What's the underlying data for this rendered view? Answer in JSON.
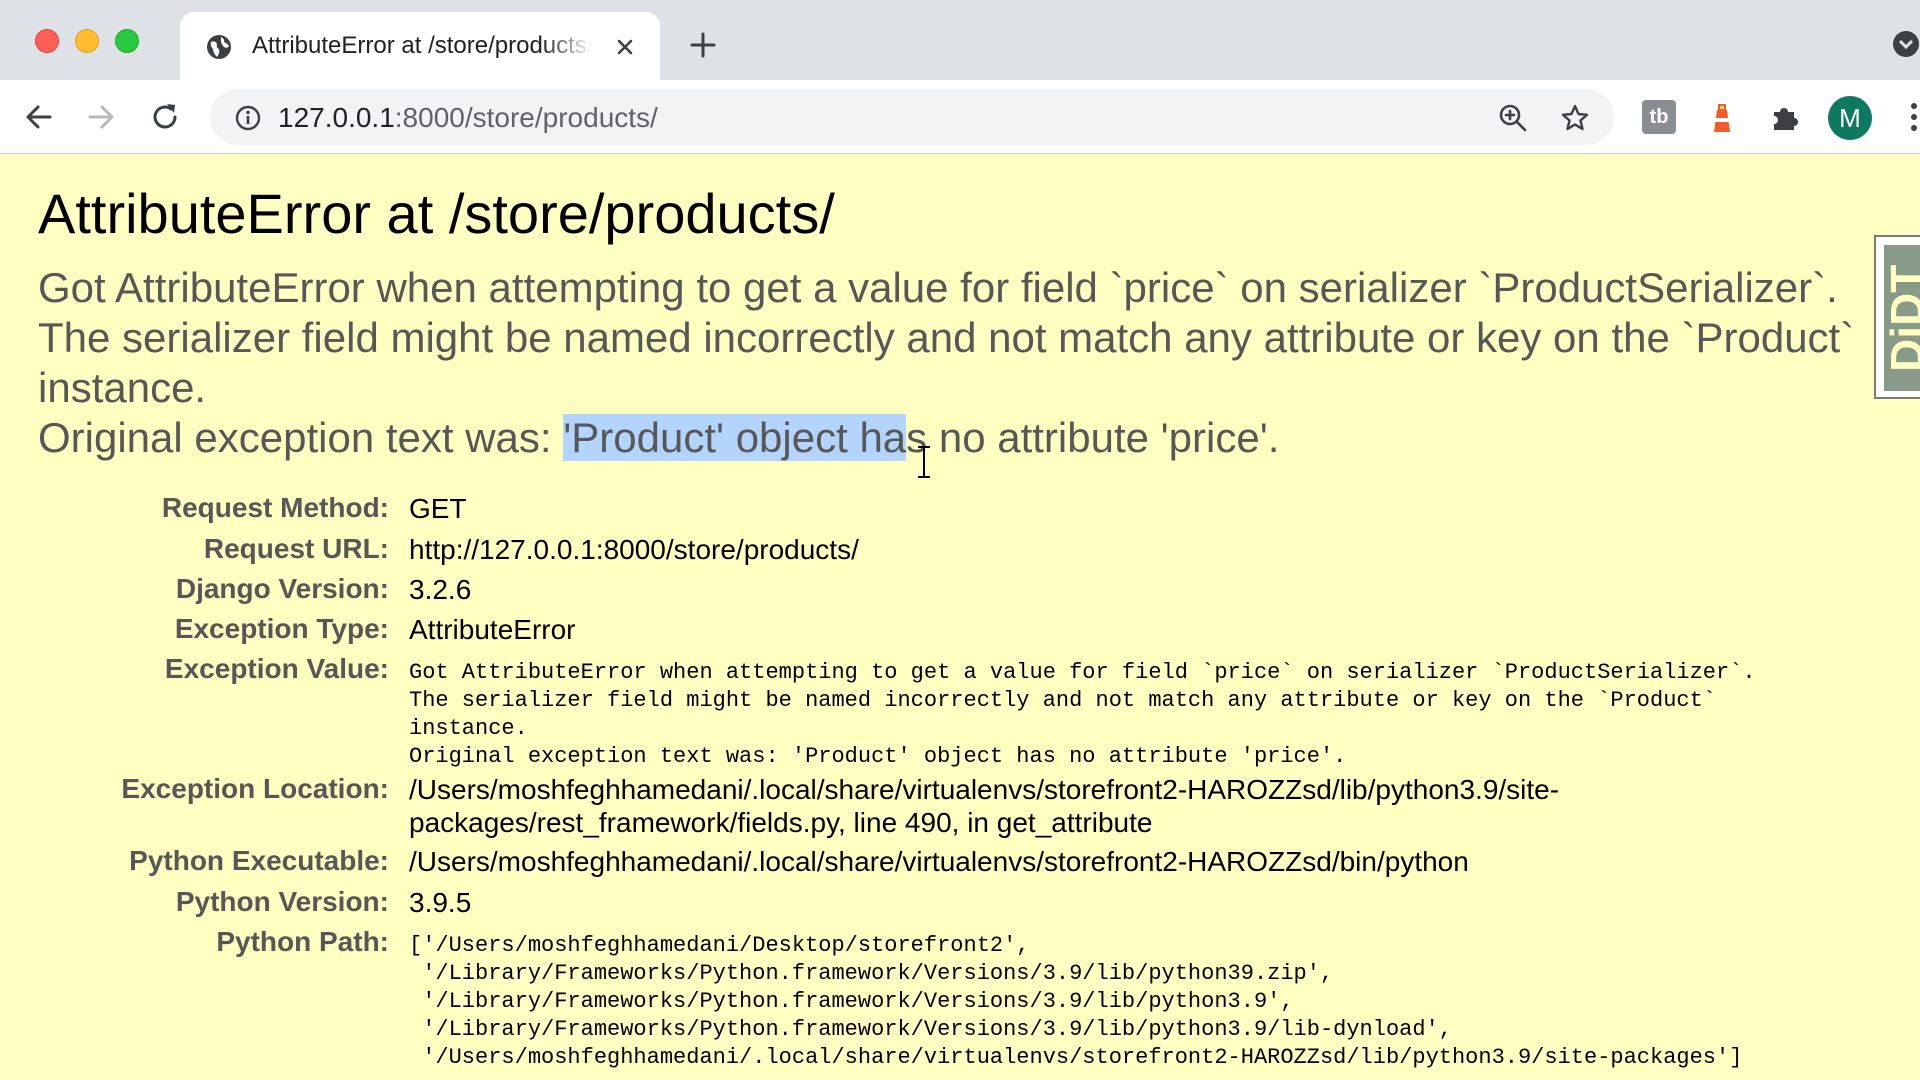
{
  "browser": {
    "tab_title": "AttributeError at /store/products/",
    "url_host": "127.0.0.1",
    "url_rest": ":8000/store/products/",
    "avatar_letter": "M",
    "extension_tb_label": "tb",
    "traffic_colors": {
      "close": "#fe5f57",
      "minimize": "#febc2e",
      "maximize": "#28c840"
    },
    "icons": [
      "globe-icon",
      "close-icon",
      "plus-icon",
      "back-arrow-icon",
      "forward-arrow-icon",
      "reload-icon",
      "info-icon",
      "zoom-icon",
      "star-icon",
      "lighthouse-icon",
      "puzzle-icon",
      "more-vertical-icon",
      "tab-search-icon"
    ]
  },
  "page": {
    "background_color": "#ffffc2",
    "title": "AttributeError at /store/products/",
    "message_lines": [
      "Got AttributeError when attempting to get a value for field `price` on serializer `ProductSerializer`.",
      "The serializer field might be named incorrectly and not match any attribute or key on the `Product`",
      "instance."
    ],
    "original_prefix": "Original exception text was: ",
    "original_selected": "'Product' object ha",
    "original_suffix": "s no attribute 'price'.",
    "selection_color": "#b3d4fd",
    "side_tab_text": "DjDT"
  },
  "meta": {
    "request_method": {
      "label": "Request Method:",
      "value": "GET"
    },
    "request_url": {
      "label": "Request URL:",
      "value": "http://127.0.0.1:8000/store/products/"
    },
    "django_version": {
      "label": "Django Version:",
      "value": "3.2.6"
    },
    "exception_type": {
      "label": "Exception Type:",
      "value": "AttributeError"
    },
    "exception_value": {
      "label": "Exception Value:",
      "lines": [
        "Got AttributeError when attempting to get a value for field `price` on serializer `ProductSerializer`.",
        "The serializer field might be named incorrectly and not match any attribute or key on the `Product`",
        "instance.",
        "Original exception text was: 'Product' object has no attribute 'price'."
      ]
    },
    "exception_location": {
      "label": "Exception Location:",
      "lines": [
        "/Users/moshfeghhamedani/.local/share/virtualenvs/storefront2-HAROZZsd/lib/python3.9/site-",
        "packages/rest_framework/fields.py, line 490, in get_attribute"
      ]
    },
    "python_executable": {
      "label": "Python Executable:",
      "value": "/Users/moshfeghhamedani/.local/share/virtualenvs/storefront2-HAROZZsd/bin/python"
    },
    "python_version": {
      "label": "Python Version:",
      "value": "3.9.5"
    },
    "python_path": {
      "label": "Python Path:",
      "lines": [
        "['/Users/moshfeghhamedani/Desktop/storefront2',",
        " '/Library/Frameworks/Python.framework/Versions/3.9/lib/python39.zip',",
        " '/Library/Frameworks/Python.framework/Versions/3.9/lib/python3.9',",
        " '/Library/Frameworks/Python.framework/Versions/3.9/lib/python3.9/lib-dynload',",
        " '/Users/moshfeghhamedani/.local/share/virtualenvs/storefront2-HAROZZsd/lib/python3.9/site-packages']"
      ]
    }
  }
}
